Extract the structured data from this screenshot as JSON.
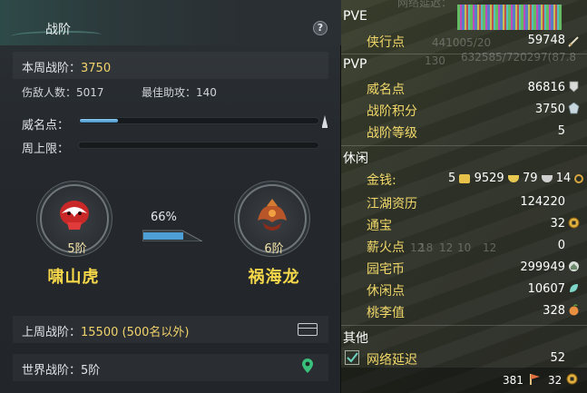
{
  "left": {
    "title": "战阶",
    "help": "?",
    "this_week_label": "本周战阶：",
    "this_week_value": "3750",
    "kills_label": "伤敌人数：5017",
    "assists_label": "最佳助攻：140",
    "prestige_label": "威名点：",
    "prestige_fill": 0.16,
    "weekly_cap_label": "周上限：",
    "weekly_cap_fill": 0,
    "current_rank": "5阶",
    "current_name": "啸山虎",
    "progress_pct": "66%",
    "progress_fill": 0.66,
    "next_rank": "6阶",
    "next_name": "祸海龙",
    "last_week_label": "上周战阶：",
    "last_week_value": "15500 (500名以外)",
    "world_label": "世界战阶：5阶"
  },
  "right": {
    "pve_title": "PVE",
    "pvp_title": "PVP",
    "leisure_title": "休闲",
    "other_title": "其他",
    "ghost_top": "网络延迟：",
    "ghost_a": "441005/20",
    "ghost_b": "632585/720297(87.8",
    "ghost_c": "130",
    "ghost_nums": [
      "18",
      "10",
      "12",
      "12",
      "12"
    ],
    "pve_rows": [
      {
        "label": "侠行点",
        "value": "59748"
      }
    ],
    "pvp_rows": [
      {
        "label": "威名点",
        "value": "86816"
      },
      {
        "label": "战阶积分",
        "value": "3750"
      },
      {
        "label": "战阶等级",
        "value": "5"
      }
    ],
    "gold_label": "金钱:",
    "gold_parts": [
      "5",
      "9529",
      "79",
      "14"
    ],
    "leisure_rows": [
      {
        "label": "江湖资历",
        "value": "124220"
      },
      {
        "label": "通宝",
        "value": "32"
      },
      {
        "label": "薪火点",
        "value": "0"
      },
      {
        "label": "园宅币",
        "value": "299949"
      },
      {
        "label": "休闲点",
        "value": "10607"
      },
      {
        "label": "桃李值",
        "value": "328"
      }
    ],
    "other_rows": [
      {
        "label": "网络延迟",
        "value": "52"
      }
    ],
    "bottom_a": "381",
    "bottom_b": "32"
  }
}
